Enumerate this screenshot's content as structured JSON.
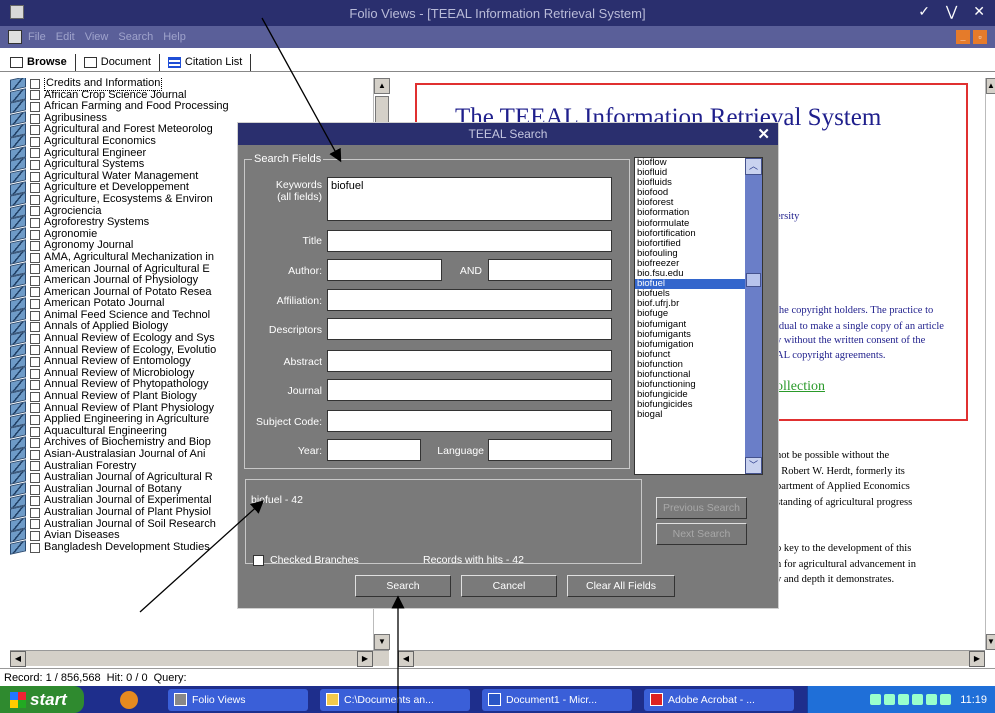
{
  "window": {
    "title": "Folio Views - [TEEAL Information Retrieval System]",
    "controls": "✓ ⋁ ✕"
  },
  "menu": [
    "File",
    "Edit",
    "View",
    "Search",
    "Help"
  ],
  "tabs": [
    {
      "label": "Browse"
    },
    {
      "label": "Document"
    },
    {
      "label": "Citation List"
    }
  ],
  "tree": {
    "items": [
      "Credits and Information",
      "African Crop Science Journal",
      "African Farming and Food Processing",
      "Agribusiness",
      "Agricultural and Forest Meteorolog",
      "Agricultural Economics",
      "Agricultural Engineer",
      "Agricultural Systems",
      "Agricultural Water Management",
      "Agriculture et Developpement",
      "Agriculture, Ecosystems & Environ",
      "Agrociencia",
      "Agroforestry Systems",
      "Agronomie",
      "Agronomy Journal",
      "AMA, Agricultural Mechanization in",
      "American Journal of Agricultural E",
      "American Journal of Physiology",
      "American Journal of Potato Resea",
      "American Potato Journal",
      "Animal Feed Science and Technol",
      "Annals of Applied Biology",
      "Annual Review of Ecology and Sys",
      "Annual Review of Ecology, Evolutio",
      "Annual Review of Entomology",
      "Annual Review of Microbiology",
      "Annual Review of Phytopathology",
      "Annual Review of Plant Biology",
      "Annual Review of Plant Physiology",
      "Applied Engineering in Agriculture",
      "Aquacultural Engineering",
      "Archives of Biochemistry and Biop",
      "Asian-Australasian Journal of Ani",
      "Australian Forestry",
      "Australian Journal of Agricultural R",
      "Australian Journal of Botany",
      "Australian Journal of Experimental",
      "Australian Journal of Plant Physiol",
      "Australian Journal of Soil Research",
      "Avian Diseases",
      "Bangladesh Development Studies"
    ]
  },
  "document": {
    "title": "The TEEAL Information Retrieval System",
    "lines": [
      "ersity",
      "the copyright holders. The practice to",
      "idual to make a single copy of an article",
      "y without the written consent of the",
      "AL copyright agreements."
    ],
    "link": "ollection",
    "body": [
      "not be possible without the",
      ". Robert  W. Herdt, formerly its",
      "partment of Applied Economics",
      "standing of agricultural progress",
      "o key to the development of this",
      "n for agricultural advancement in",
      "y and depth it demonstrates."
    ]
  },
  "status": {
    "record": "Record: 1 / 856,568",
    "hit": "Hit: 0 / 0",
    "query": "Query:"
  },
  "taskbar": {
    "start": "start",
    "buttons": [
      "Folio Views",
      "C:\\Documents an...",
      "Document1 - Micr...",
      "Adobe Acrobat - ..."
    ],
    "clock": "11:19"
  },
  "dialog": {
    "title": "TEEAL Search",
    "legend": "Search Fields",
    "labels": {
      "keywords": "Keywords\n(all fields)",
      "title": "Title",
      "author": "Author:",
      "and": "AND",
      "affiliation": "Affiliation:",
      "descriptors": "Descriptors",
      "abstract": "Abstract",
      "journal": "Journal",
      "subject": "Subject Code:",
      "year": "Year:",
      "language": "Language"
    },
    "values": {
      "keywords": "biofuel"
    },
    "wordlist": [
      "bioflow",
      "biofluid",
      "biofluids",
      "biofood",
      "bioforest",
      "bioformation",
      "bioformulate",
      "biofortification",
      "biofortified",
      "biofouling",
      "biofreezer",
      "bio.fsu.edu",
      "biofuel",
      "biofuels",
      "biof.ufrj.br",
      "biofuge",
      "biofumigant",
      "biofumigants",
      "biofumigation",
      "biofunct",
      "biofunction",
      "biofunctional",
      "biofunctioning",
      "biofungicide",
      "biofungicides",
      "biogal"
    ],
    "selected_word": "biofuel",
    "results": "biofuel - 42",
    "buttons": {
      "previous": "Previous Search",
      "next": "Next Search",
      "search": "Search",
      "cancel": "Cancel",
      "clear": "Clear All Fields"
    },
    "checked_branches": "Checked Branches",
    "records": "Records with hits -   42"
  }
}
